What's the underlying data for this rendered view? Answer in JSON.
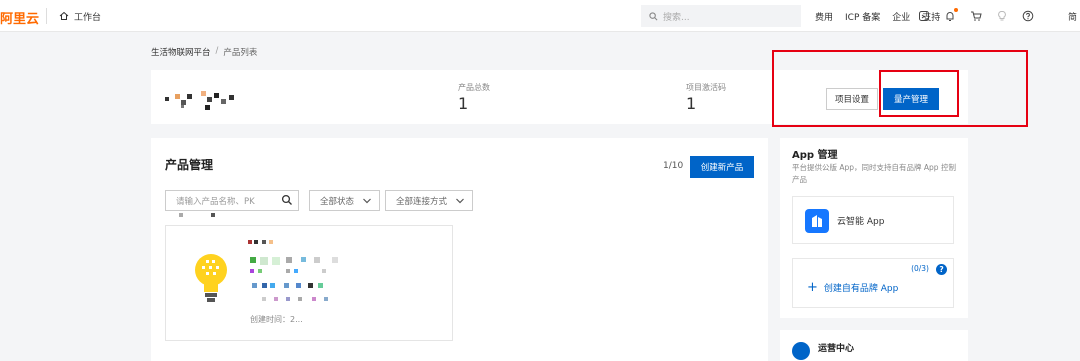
{
  "topbar": {
    "logo": "阿里云",
    "workbench": "工作台",
    "search_placeholder": "搜索...",
    "links": [
      "费用",
      "ICP 备案",
      "企业",
      "支持"
    ],
    "icons": [
      "terminal-icon",
      "bell-icon",
      "cart-icon",
      "bulb-icon",
      "help-icon"
    ],
    "cut_text": "简"
  },
  "breadcrumb": {
    "parent": "生活物联网平台",
    "separator": "/",
    "current": "产品列表"
  },
  "summary": {
    "stats": [
      {
        "label": "产品总数",
        "value": "1"
      },
      {
        "label": "项目激活码",
        "value": "1"
      }
    ],
    "settings_button": "项目设置",
    "mass_button": "量产管理"
  },
  "products": {
    "title": "产品管理",
    "count": "1/10",
    "new_button": "创建新产品",
    "search_placeholder": "请输入产品名称、PK",
    "status_filter": "全部状态",
    "connection_filter": "全部连接方式",
    "card": {
      "created_label": "创建时间：2..."
    }
  },
  "app_panel": {
    "title": "App 管理",
    "description": "平台提供公版 App，同时支持自有品牌 App 控制产品",
    "app_name": "云智能 App",
    "brand_count": "(0/3)",
    "brand_create": "创建自有品牌 App"
  },
  "ops": {
    "title": "运营中心"
  },
  "colors": {
    "primary": "#0064c8",
    "brand": "#ff6a00",
    "highlight": "#e60012"
  }
}
